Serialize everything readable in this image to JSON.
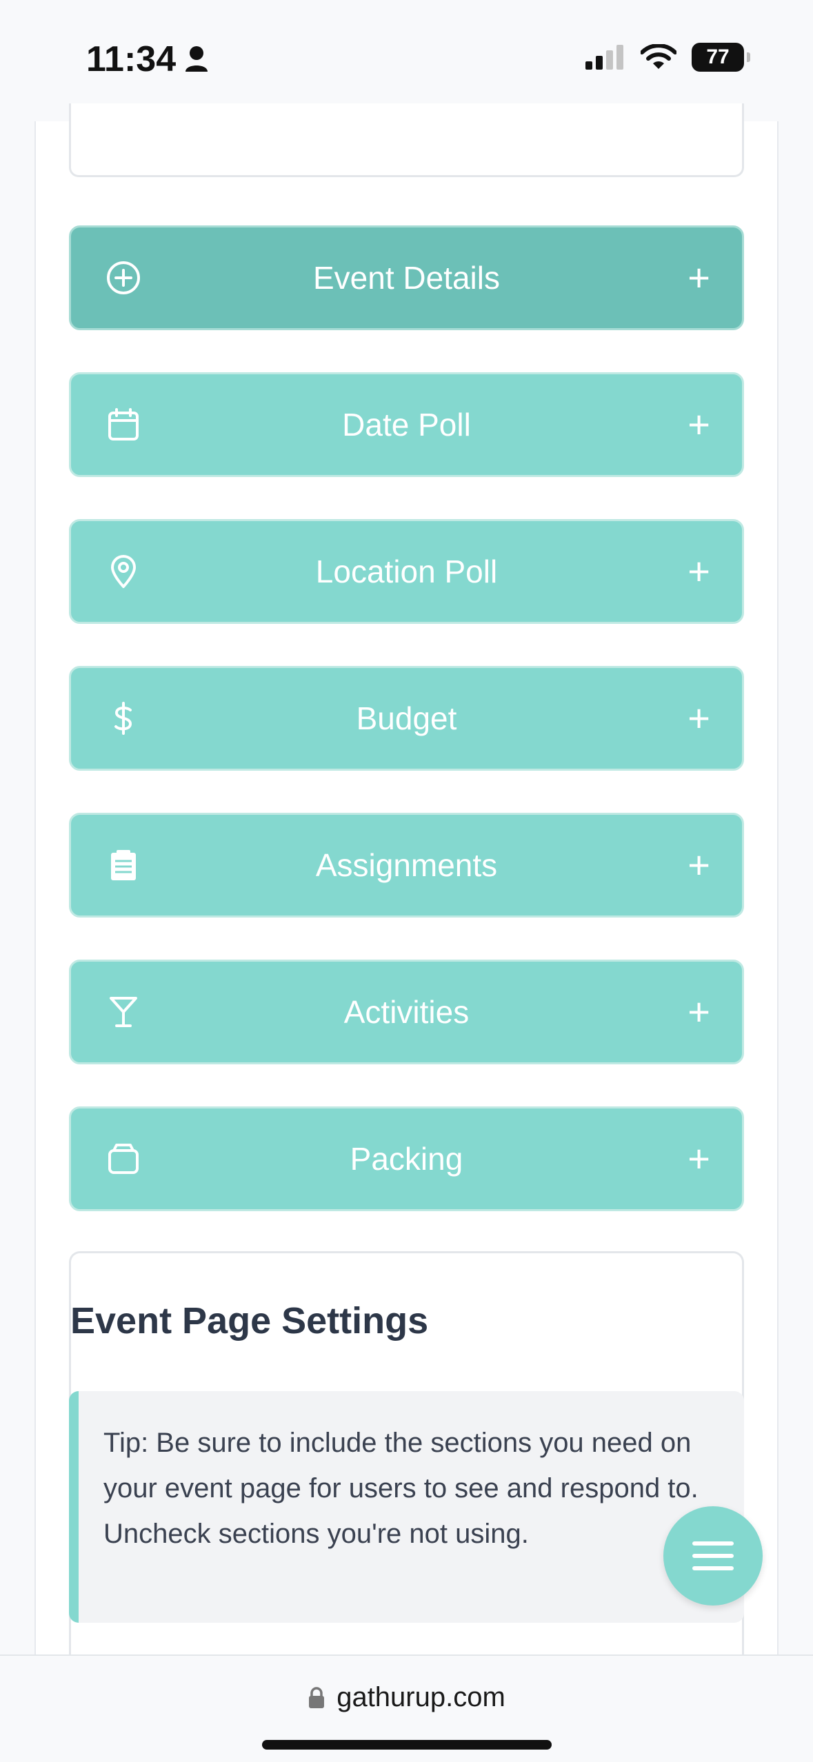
{
  "status_bar": {
    "time": "11:34",
    "battery": "77"
  },
  "sections": [
    {
      "label": "Event Details",
      "icon": "plus-circle-icon"
    },
    {
      "label": "Date Poll",
      "icon": "calendar-icon"
    },
    {
      "label": "Location Poll",
      "icon": "map-pin-icon"
    },
    {
      "label": "Budget",
      "icon": "dollar-icon"
    },
    {
      "label": "Assignments",
      "icon": "clipboard-icon"
    },
    {
      "label": "Activities",
      "icon": "cocktail-icon"
    },
    {
      "label": "Packing",
      "icon": "bag-icon"
    }
  ],
  "plus_symbol": "+",
  "settings": {
    "title": "Event Page Settings",
    "tip": "Tip: Be sure to include the sections you need on your event page for users to see and respond to. Uncheck sections you're not using."
  },
  "browser": {
    "url": "gathurup.com"
  },
  "colors": {
    "accent": "#84d8cf",
    "accent_active": "#6cc0b7",
    "text": "#2d3748"
  }
}
